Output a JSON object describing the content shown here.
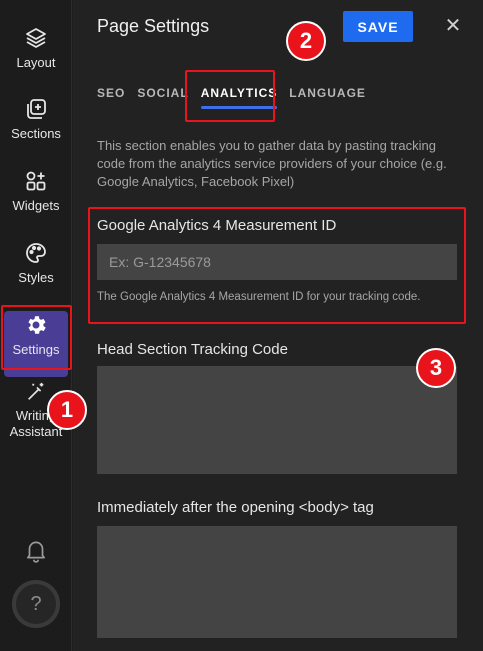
{
  "sidebar": {
    "items": [
      {
        "label": "Layout",
        "icon": "layers-icon"
      },
      {
        "label": "Sections",
        "icon": "add-section-icon"
      },
      {
        "label": "Widgets",
        "icon": "widgets-icon"
      },
      {
        "label": "Styles",
        "icon": "palette-icon"
      },
      {
        "label": "Settings",
        "icon": "gear-icon",
        "active": true
      },
      {
        "label": "Writing Assistant",
        "icon": "magic-wand-icon"
      }
    ],
    "help_label": "?"
  },
  "panel": {
    "title": "Page Settings",
    "save_label": "SAVE",
    "close_label": "✕",
    "tabs": [
      "SEO",
      "SOCIAL",
      "ANALYTICS",
      "LANGUAGE"
    ],
    "active_tab": "ANALYTICS",
    "description": "This section enables you to gather data by pasting tracking code from the analytics service providers of your choice (e.g. Google Analytics, Facebook Pixel)",
    "ga_field": {
      "label": "Google Analytics 4 Measurement ID",
      "placeholder": "Ex: G-12345678",
      "value": "",
      "help": "The Google Analytics 4 Measurement ID for your tracking code."
    },
    "head_code": {
      "label": "Head Section Tracking Code",
      "value": ""
    },
    "body_code": {
      "label": "Immediately after the opening <body> tag",
      "value": ""
    }
  },
  "annotations": [
    "1",
    "2",
    "3"
  ],
  "colors": {
    "accent": "#1f6bf0",
    "active_nav": "#4a3d96",
    "annotation": "#e8131b"
  }
}
